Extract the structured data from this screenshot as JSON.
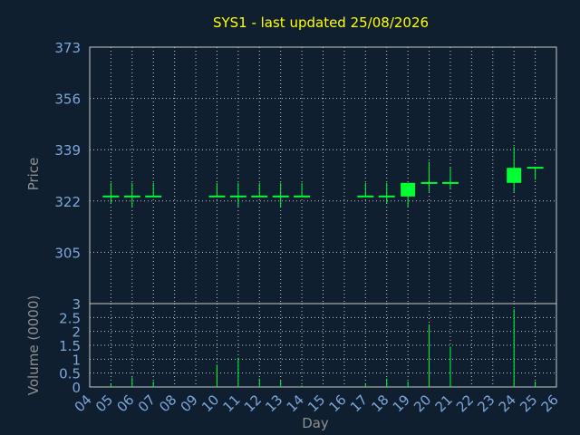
{
  "chart_data": [
    {
      "type": "candlestick",
      "title": "SYS1 - last updated 25/08/2026",
      "ylabel": "Price",
      "xlabel": "",
      "ylim": [
        288,
        373
      ],
      "yticks": [
        305,
        322,
        339,
        356,
        373
      ],
      "x": [
        "05",
        "06",
        "07",
        "10",
        "11",
        "12",
        "13",
        "14",
        "17",
        "18",
        "19",
        "20",
        "21",
        "24",
        "25"
      ],
      "open": [
        323.5,
        323.5,
        323.5,
        323.5,
        323.5,
        323.5,
        323.5,
        323.5,
        323.5,
        323.5,
        323.5,
        328.0,
        328.0,
        328.0,
        333.0
      ],
      "high": [
        328.0,
        328.0,
        328.0,
        328.0,
        328.0,
        328.0,
        328.0,
        328.0,
        328.0,
        328.0,
        328.0,
        335.0,
        333.0,
        340.0,
        333.0
      ],
      "low": [
        321.0,
        320.0,
        323.5,
        323.5,
        320.0,
        323.5,
        320.0,
        323.5,
        323.5,
        321.0,
        320.0,
        325.0,
        326.0,
        325.0,
        329.0
      ],
      "close": [
        323.5,
        323.5,
        323.5,
        323.5,
        323.5,
        323.5,
        323.5,
        323.5,
        323.5,
        323.5,
        328.0,
        328.0,
        328.0,
        333.0,
        333.0
      ]
    },
    {
      "type": "bar",
      "ylabel": "Volume (0000)",
      "xlabel": "Day",
      "ylim": [
        0,
        3
      ],
      "yticks": [
        0,
        0.5,
        1,
        1.5,
        2,
        2.5,
        3
      ],
      "categories": [
        "04",
        "05",
        "06",
        "07",
        "08",
        "09",
        "10",
        "11",
        "12",
        "13",
        "14",
        "15",
        "16",
        "17",
        "18",
        "19",
        "20",
        "21",
        "22",
        "23",
        "24",
        "25",
        "26"
      ],
      "values": [
        0,
        0.1,
        0.35,
        0.2,
        0,
        0,
        0.8,
        1.05,
        0.3,
        0.25,
        0.05,
        0,
        0,
        0.1,
        0.3,
        0.2,
        2.25,
        1.45,
        0,
        0,
        2.8,
        0.2,
        0
      ]
    }
  ],
  "colors": {
    "background": "#0f1f30",
    "text": "#7da7d9",
    "title": "#ffff00",
    "axis_title": "#8f8f8f",
    "grid": "#c8c8c8",
    "candle": "#00ff33"
  }
}
